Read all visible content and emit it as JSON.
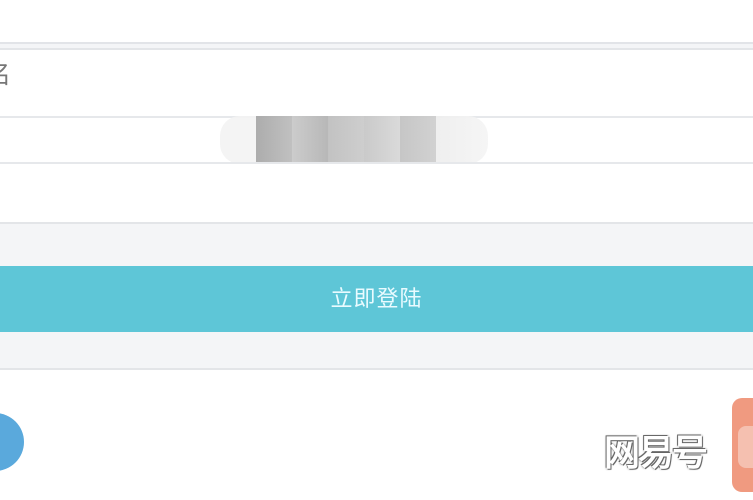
{
  "form": {
    "username_label": "名"
  },
  "login": {
    "button_label": "立即登陆"
  },
  "watermark": {
    "text": "网易号"
  }
}
